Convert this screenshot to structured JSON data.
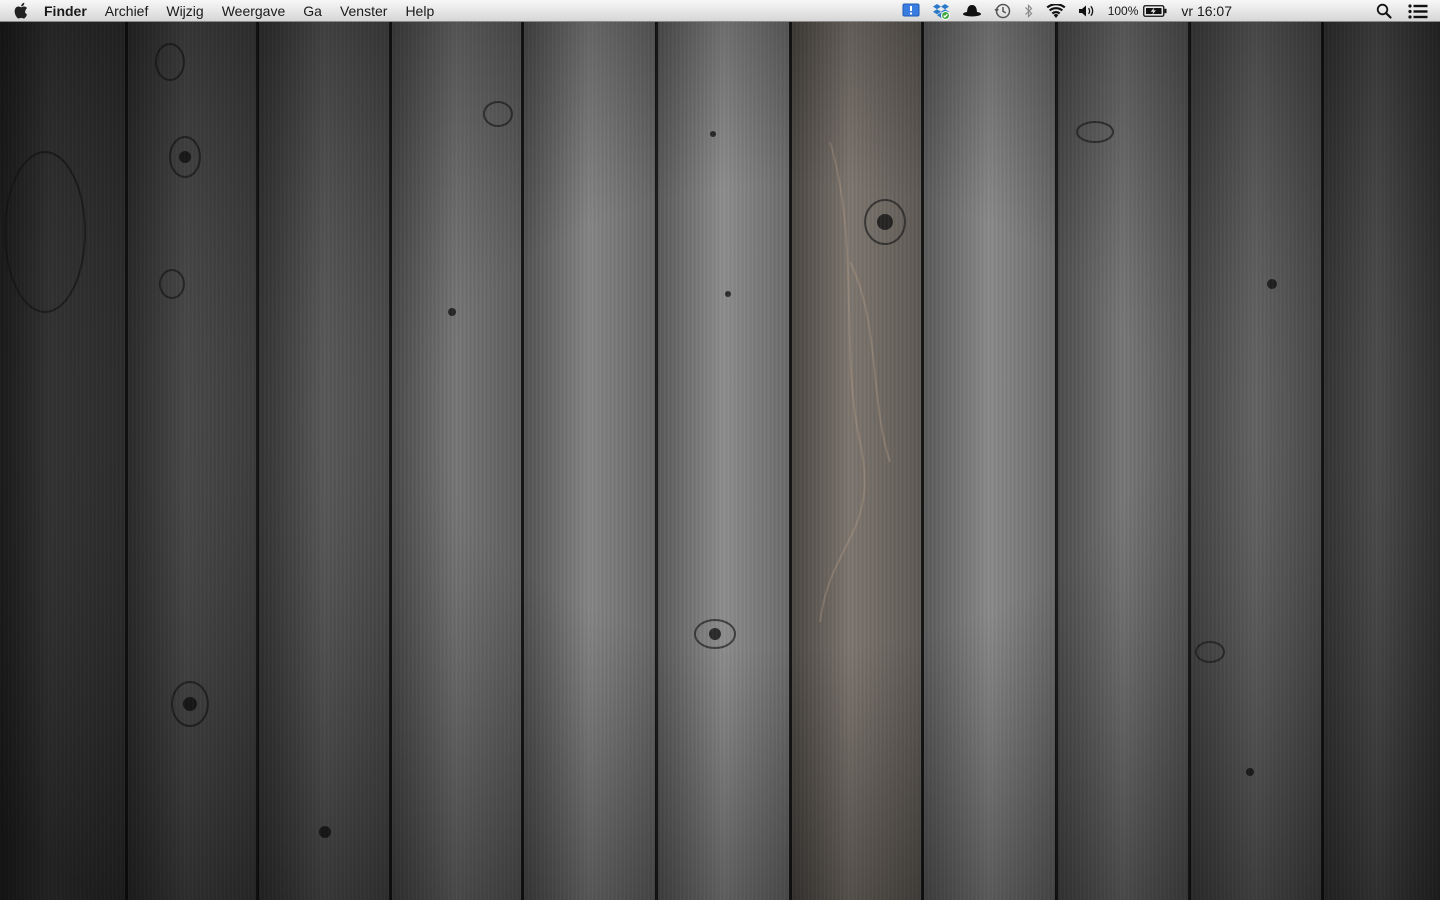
{
  "menubar": {
    "apple_icon": "apple-logo-icon",
    "app_name": "Finder",
    "menus": [
      "Archief",
      "Wijzig",
      "Weergave",
      "Ga",
      "Venster",
      "Help"
    ],
    "status_icons": [
      "notification-icon",
      "dropbox-icon",
      "hat-icon",
      "time-machine-icon",
      "bluetooth-icon",
      "wifi-icon",
      "volume-icon"
    ],
    "battery_percent": "100%",
    "battery_icon": "battery-charging-icon",
    "clock": "vr 16:07",
    "search_icon": "spotlight-search-icon",
    "list_icon": "notification-center-icon"
  },
  "wallpaper": {
    "description_icon": "wood-planks-wallpaper"
  }
}
